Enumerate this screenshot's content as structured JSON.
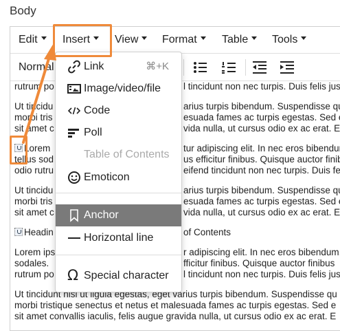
{
  "field_label": "Body",
  "menubar": {
    "items": [
      {
        "label": "Edit"
      },
      {
        "label": "Insert"
      },
      {
        "label": "View"
      },
      {
        "label": "Format"
      },
      {
        "label": "Table"
      },
      {
        "label": "Tools"
      }
    ]
  },
  "toolbar": {
    "format_label": "Normal",
    "icons": [
      "bullet-list-icon",
      "numbered-list-icon",
      "outdent-icon",
      "indent-icon"
    ]
  },
  "insert_menu": {
    "items": [
      {
        "label": "Link",
        "shortcut": "⌘+K",
        "icon": "link-icon"
      },
      {
        "label": "Image/video/file",
        "icon": "image-icon"
      },
      {
        "label": "Code",
        "icon": "code-icon"
      },
      {
        "label": "Poll",
        "icon": "poll-icon"
      },
      {
        "label": "Table of Contents",
        "disabled": true
      },
      {
        "label": "Emoticon",
        "icon": "emoticon-icon"
      },
      {
        "label": "Anchor",
        "active": true,
        "icon": "bookmark-icon"
      },
      {
        "label": "Horizontal line",
        "icon": "horizontal-line-icon"
      },
      {
        "label": "Special character",
        "icon": "omega-icon"
      }
    ]
  },
  "content": {
    "lines": [
      "rutrum po",
      "l tincidunt non nec turpis. Duis felis just",
      "Ut tincidu",
      "arius turpis bibendum. Suspendisse qu",
      "morbi tris",
      "esuada fames ac turpis egestas. Sed e",
      "sit amet c",
      "vida nulla, ut cursus odio ex ac erat. E",
      "Lorem",
      "tur adipiscing elit. In nec eros bibendun",
      "tellus sod",
      "us efficitur finibus. Quisque auctor finib",
      "odio rutru",
      "eifend tincidunt non nec turpis. Duis felis",
      "Ut tincidu",
      "arius turpis bibendum. Suspendisse qu",
      "morbi tris",
      "esuada fames ac turpis egestas. Sed e",
      "sit amet c",
      "vida nulla, ut cursus odio ex ac erat. E",
      "Headin",
      "of Contents",
      "Lorem ips",
      "r adipiscing elit. In nec eros bibendum,",
      "sodales.",
      "fficitur finibus. Quisque auctor finibus",
      "rutrum po",
      "l tincidunt non nec turpis. Duis felis just",
      "Ut tincidunt nisl ut ligula egestas, eget varius turpis bibendum. Suspendisse qu",
      "morbi tristique senectus et netus et malesuada fames ac turpis egestas. Sed e",
      "sit amet convallis iaculis, felis augue gravida nulla, ut cursus odio ex ac erat. E"
    ]
  },
  "colors": {
    "highlight": "#ef8a3a",
    "active_item": "#7a7a7a"
  }
}
